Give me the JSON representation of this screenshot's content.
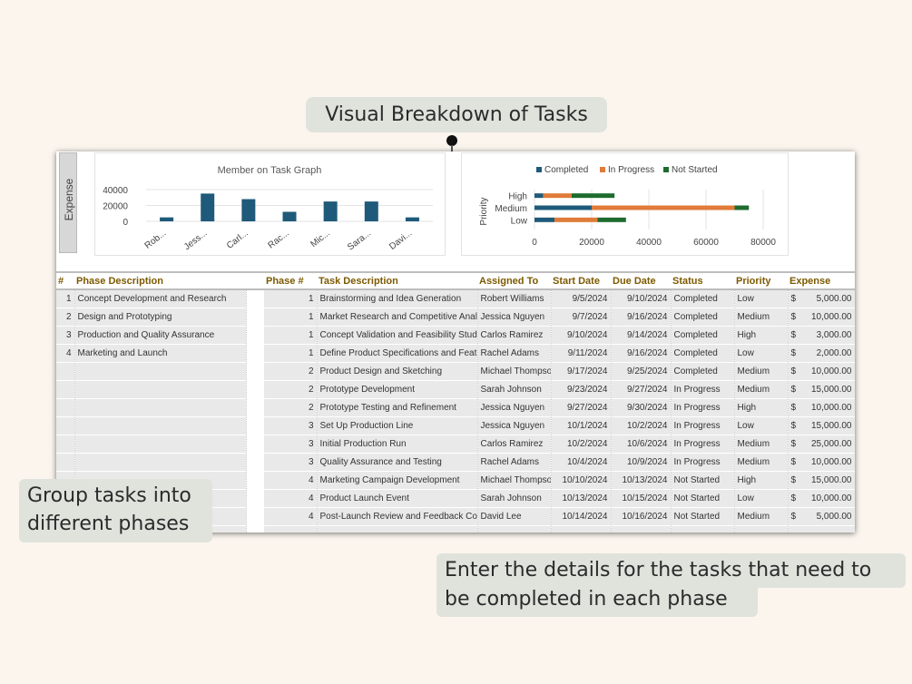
{
  "callouts": {
    "title": "Visual Breakdown of Tasks",
    "group_line1": "Group tasks into",
    "group_line2": "different phases",
    "enter_line1": "Enter the details for the tasks that need to",
    "enter_line2": "be completed in each phase"
  },
  "sheet": {
    "expense_tab_label": "Expense"
  },
  "chart_data": [
    {
      "type": "bar",
      "title": "Member on Task Graph",
      "categories": [
        "Rob...",
        "Jess...",
        "Carl...",
        "Rac...",
        "Mic...",
        "Sara...",
        "Davi..."
      ],
      "values": [
        5000,
        35000,
        28000,
        12000,
        25000,
        25000,
        5000
      ],
      "ylim": [
        0,
        40000
      ],
      "yticks": [
        0,
        20000,
        40000
      ],
      "color": "#1f5a7a"
    },
    {
      "type": "bar",
      "orientation": "horizontal",
      "stacked": true,
      "ylabel": "Priority",
      "categories": [
        "High",
        "Medium",
        "Low"
      ],
      "series": [
        {
          "name": "Completed",
          "values": [
            3000,
            20000,
            7000
          ],
          "color": "#1f5a7a"
        },
        {
          "name": "In Progress",
          "values": [
            10000,
            50000,
            15000
          ],
          "color": "#e07b39"
        },
        {
          "name": "Not Started",
          "values": [
            15000,
            5000,
            10000
          ],
          "color": "#1e6b2e"
        }
      ],
      "xlim": [
        0,
        80000
      ],
      "xticks": [
        0,
        20000,
        40000,
        60000,
        80000
      ],
      "legend": "top"
    }
  ],
  "phase_table": {
    "headers": [
      "#",
      "Phase Description"
    ],
    "rows": [
      [
        "1",
        "Concept Development and Research"
      ],
      [
        "2",
        "Design and Prototyping"
      ],
      [
        "3",
        "Production and Quality Assurance"
      ],
      [
        "4",
        "Marketing and Launch"
      ]
    ]
  },
  "task_table": {
    "headers": [
      "Phase #",
      "Task Description",
      "Assigned To",
      "Start Date",
      "Due Date",
      "Status",
      "Priority",
      "Expense"
    ],
    "currency_symbol": "$",
    "rows": [
      [
        "1",
        "Brainstorming and Idea Generation",
        "Robert Williams",
        "9/5/2024",
        "9/10/2024",
        "Completed",
        "Low",
        "5,000.00"
      ],
      [
        "1",
        "Market Research and Competitive Analysis",
        "Jessica Nguyen",
        "9/7/2024",
        "9/16/2024",
        "Completed",
        "Medium",
        "10,000.00"
      ],
      [
        "1",
        "Concept Validation and Feasibility Study",
        "Carlos Ramirez",
        "9/10/2024",
        "9/14/2024",
        "Completed",
        "High",
        "3,000.00"
      ],
      [
        "1",
        "Define Product Specifications and Features",
        "Rachel Adams",
        "9/11/2024",
        "9/16/2024",
        "Completed",
        "Low",
        "2,000.00"
      ],
      [
        "2",
        "Product Design and Sketching",
        "Michael Thompson",
        "9/17/2024",
        "9/25/2024",
        "Completed",
        "Medium",
        "10,000.00"
      ],
      [
        "2",
        "Prototype Development",
        "Sarah Johnson",
        "9/23/2024",
        "9/27/2024",
        "In Progress",
        "Medium",
        "15,000.00"
      ],
      [
        "2",
        "Prototype Testing and Refinement",
        "Jessica Nguyen",
        "9/27/2024",
        "9/30/2024",
        "In Progress",
        "High",
        "10,000.00"
      ],
      [
        "3",
        "Set Up Production Line",
        "Jessica Nguyen",
        "10/1/2024",
        "10/2/2024",
        "In Progress",
        "Low",
        "15,000.00"
      ],
      [
        "3",
        "Initial Production Run",
        "Carlos Ramirez",
        "10/2/2024",
        "10/6/2024",
        "In Progress",
        "Medium",
        "25,000.00"
      ],
      [
        "3",
        "Quality Assurance and Testing",
        "Rachel Adams",
        "10/4/2024",
        "10/9/2024",
        "In Progress",
        "Medium",
        "10,000.00"
      ],
      [
        "4",
        "Marketing Campaign Development",
        "Michael Thompson",
        "10/10/2024",
        "10/13/2024",
        "Not Started",
        "High",
        "15,000.00"
      ],
      [
        "4",
        "Product Launch Event",
        "Sarah Johnson",
        "10/13/2024",
        "10/15/2024",
        "Not Started",
        "Low",
        "10,000.00"
      ],
      [
        "4",
        "Post-Launch Review and Feedback Collection",
        "David Lee",
        "10/14/2024",
        "10/16/2024",
        "Not Started",
        "Medium",
        "5,000.00"
      ]
    ]
  }
}
